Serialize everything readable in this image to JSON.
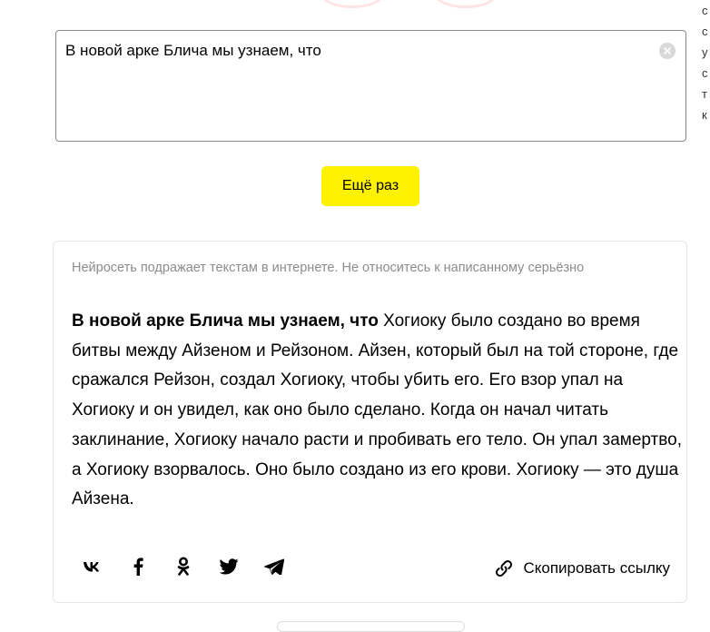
{
  "input": {
    "value": "В новой арке Блича мы узнаем, что"
  },
  "again_button": {
    "label": "Ещё раз"
  },
  "result": {
    "disclaimer": "Нейросеть подражает текстам в интернете. Не относитесь к написанному серьёзно",
    "prompt": "В новой арке Блича мы узнаем, что",
    "continuation": " Хогиоку было создано во время битвы между Айзеном и Рейзоном. Айзен, который был на той стороне, где сражался Рейзон, создал Хогиоку, чтобы убить его. Его взор упал на Хогиоку и он увидел, как оно было сделано. Когда он начал читать заклинание, Хогиоку начало расти и пробивать его тело. Он упал замертво, а Хогиоку взорвалось. Оно было создано из его крови. Хогиоку — это душа Айзена."
  },
  "share": {
    "icons": [
      "vk-icon",
      "facebook-icon",
      "odnoklassniki-icon",
      "twitter-icon",
      "telegram-icon"
    ],
    "copy_link_label": "Скопировать ссылку"
  },
  "right_edge_glyphs": [
    "с",
    "с",
    "у",
    "с",
    "т",
    "к"
  ],
  "colors": {
    "accent": "#fff200",
    "disclaimer": "#8c8c8c",
    "card_border": "#e6e6e6"
  }
}
